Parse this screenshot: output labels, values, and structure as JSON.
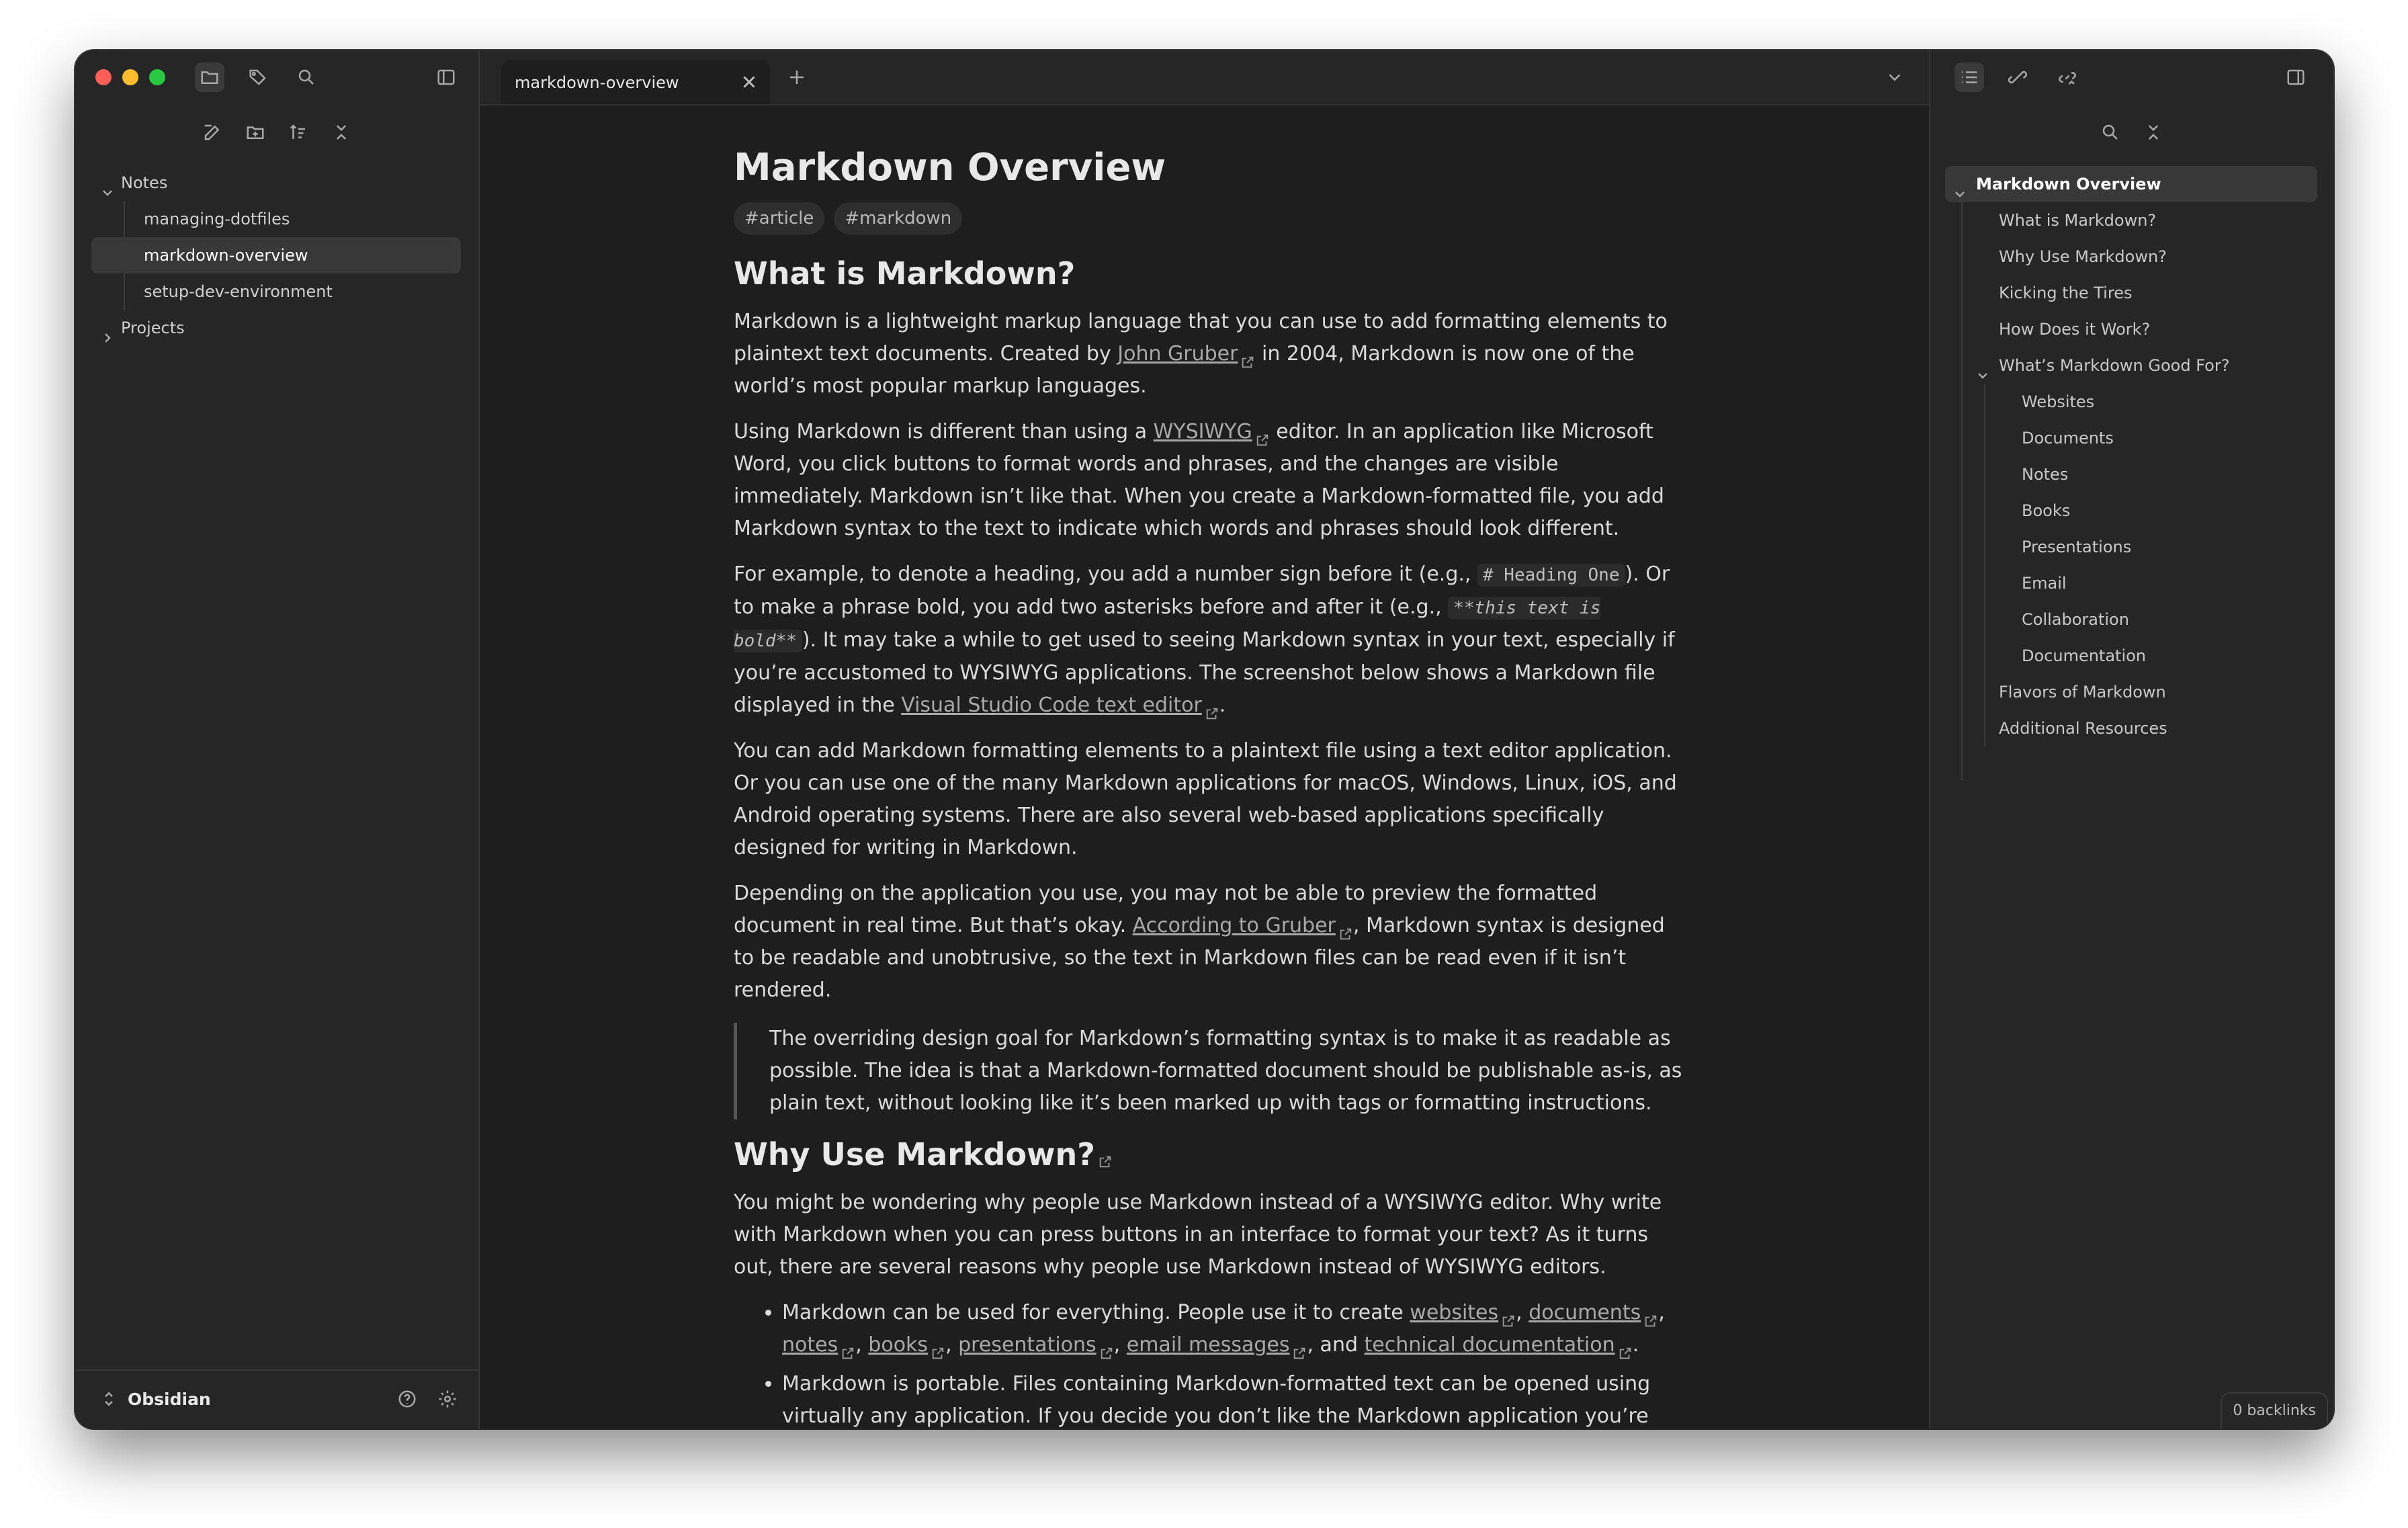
{
  "tab": {
    "title": "markdown-overview"
  },
  "sidebar": {
    "items": [
      {
        "label": "Notes"
      },
      {
        "label": "managing-dotfiles"
      },
      {
        "label": "markdown-overview"
      },
      {
        "label": "setup-dev-environment"
      },
      {
        "label": "Projects"
      }
    ],
    "vault_name": "Obsidian"
  },
  "doc": {
    "title": "Markdown Overview",
    "tags": [
      "#article",
      "#markdown"
    ],
    "h_what": "What is Markdown?",
    "p1_a": "Markdown is a lightweight markup language that you can use to add formatting elements to plaintext text documents. Created by ",
    "p1_link": "John Gruber",
    "p1_b": " in 2004, Markdown is now one of the world’s most popular markup languages.",
    "p2_a": "Using Markdown is different than using a ",
    "p2_link": "WYSIWYG",
    "p2_b": " editor. In an application like Microsoft Word, you click buttons to format words and phrases, and the changes are visible immediately. Markdown isn’t like that. When you create a Markdown-formatted file, you add Markdown syntax to the text to indicate which words and phrases should look different.",
    "p3_a": "For example, to denote a heading, you add a number sign before it (e.g., ",
    "p3_code1": "# Heading One",
    "p3_b": "). Or to make a phrase bold, you add two asterisks before and after it (e.g., ",
    "p3_code2": "**this text is bold**",
    "p3_c": "). It may take a while to get used to seeing Markdown syntax in your text, especially if you’re accustomed to WYSIWYG applications. The screenshot below shows a Markdown file displayed in the ",
    "p3_link": "Visual Studio Code text editor",
    "p3_d": ".",
    "p4": "You can add Markdown formatting elements to a plaintext file using a text editor application. Or you can use one of the many Markdown applications for macOS, Windows, Linux, iOS, and Android operating systems. There are also several web-based applications specifically designed for writing in Markdown.",
    "p5_a": "Depending on the application you use, you may not be able to preview the formatted document in real time. But that’s okay. ",
    "p5_link": "According to Gruber",
    "p5_b": ", Markdown syntax is designed to be readable and unobtrusive, so the text in Markdown files can be read even if it isn’t rendered.",
    "quote": "The overriding design goal for Markdown’s formatting syntax is to make it as readable as possible. The idea is that a Markdown-formatted document should be publishable as-is, as plain text, without looking like it’s been marked up with tags or formatting instructions.",
    "h_why": "Why Use Markdown?",
    "p6": "You might be wondering why people use Markdown instead of a WYSIWYG editor. Why write with Markdown when you can press buttons in an interface to format your text? As it turns out, there are several reasons why people use Markdown instead of WYSIWYG editors.",
    "li1_a": "Markdown can be used for everything. People use it to create ",
    "li1_links": [
      "websites",
      "documents",
      "notes",
      "books",
      "presentations",
      "email messages"
    ],
    "li1_and": ", and ",
    "li1_last": "technical documentation",
    "li1_end": ".",
    "li2": "Markdown is portable. Files containing Markdown-formatted text can be opened using virtually any application. If you decide you don’t like the Markdown application you’re currently using, you can"
  },
  "outline": {
    "items": [
      {
        "label": "Markdown Overview"
      },
      {
        "label": "What is Markdown?"
      },
      {
        "label": "Why Use Markdown?"
      },
      {
        "label": "Kicking the Tires"
      },
      {
        "label": "How Does it Work?"
      },
      {
        "label": "What’s Markdown Good For?"
      },
      {
        "label": "Websites"
      },
      {
        "label": "Documents"
      },
      {
        "label": "Notes"
      },
      {
        "label": "Books"
      },
      {
        "label": "Presentations"
      },
      {
        "label": "Email"
      },
      {
        "label": "Collaboration"
      },
      {
        "label": "Documentation"
      },
      {
        "label": "Flavors of Markdown"
      },
      {
        "label": "Additional Resources"
      }
    ]
  },
  "status": {
    "backlinks": "0 backlinks"
  },
  "colors": {
    "window_bg": "#1e1e1e",
    "panel_bg": "#262626",
    "close": "#ff5f57",
    "minimize": "#febc2e",
    "zoom": "#28c840"
  }
}
